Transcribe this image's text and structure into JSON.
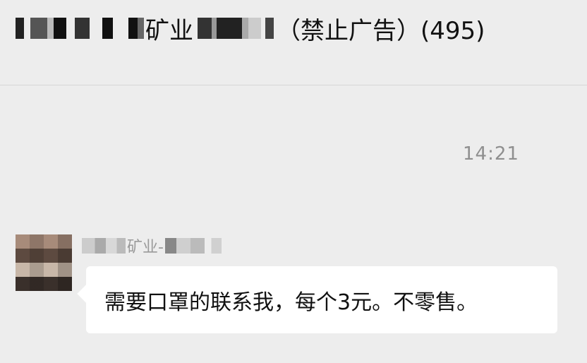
{
  "header": {
    "title_text": "矿业",
    "title_suffix": "（禁止广告）(495)"
  },
  "chat": {
    "timestamp": "14:21",
    "messages": [
      {
        "sender": "矿业-",
        "text": "需要口罩的联系我，每个3元。不零售。"
      }
    ]
  }
}
